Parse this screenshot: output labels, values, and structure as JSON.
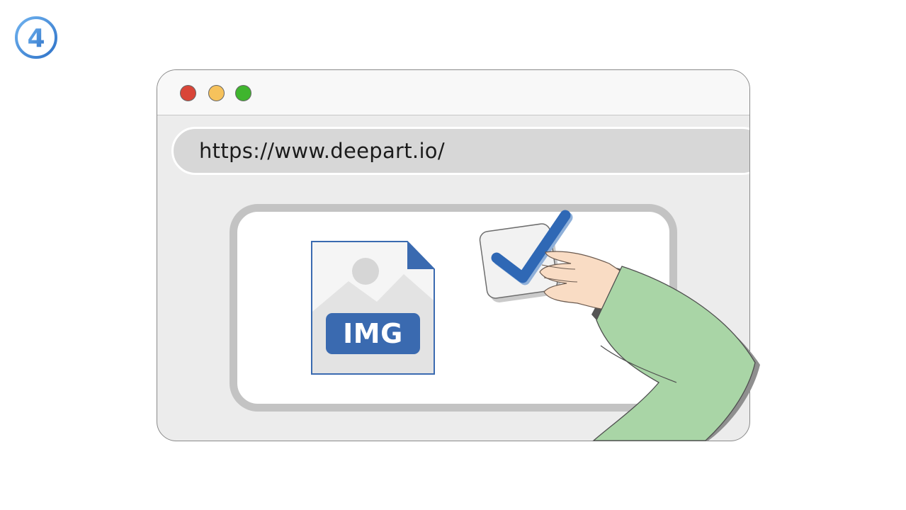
{
  "step": {
    "number": "4"
  },
  "browser": {
    "traffic_lights": [
      {
        "name": "close",
        "color": "#d94538"
      },
      {
        "name": "minimize",
        "color": "#f6c25c"
      },
      {
        "name": "maximize",
        "color": "#3fb52e"
      }
    ],
    "address_bar": {
      "url": "https://www.deepart.io/"
    }
  },
  "content": {
    "file_icon": {
      "label": "IMG",
      "icon": "image-file-icon",
      "accent": "#3a6ab0"
    },
    "checkbox": {
      "icon": "checkmark-icon",
      "checked": true,
      "accent": "#2f68b5"
    },
    "hand": {
      "icon": "hand-icon",
      "sleeve_color": "#a9d5a6"
    }
  }
}
